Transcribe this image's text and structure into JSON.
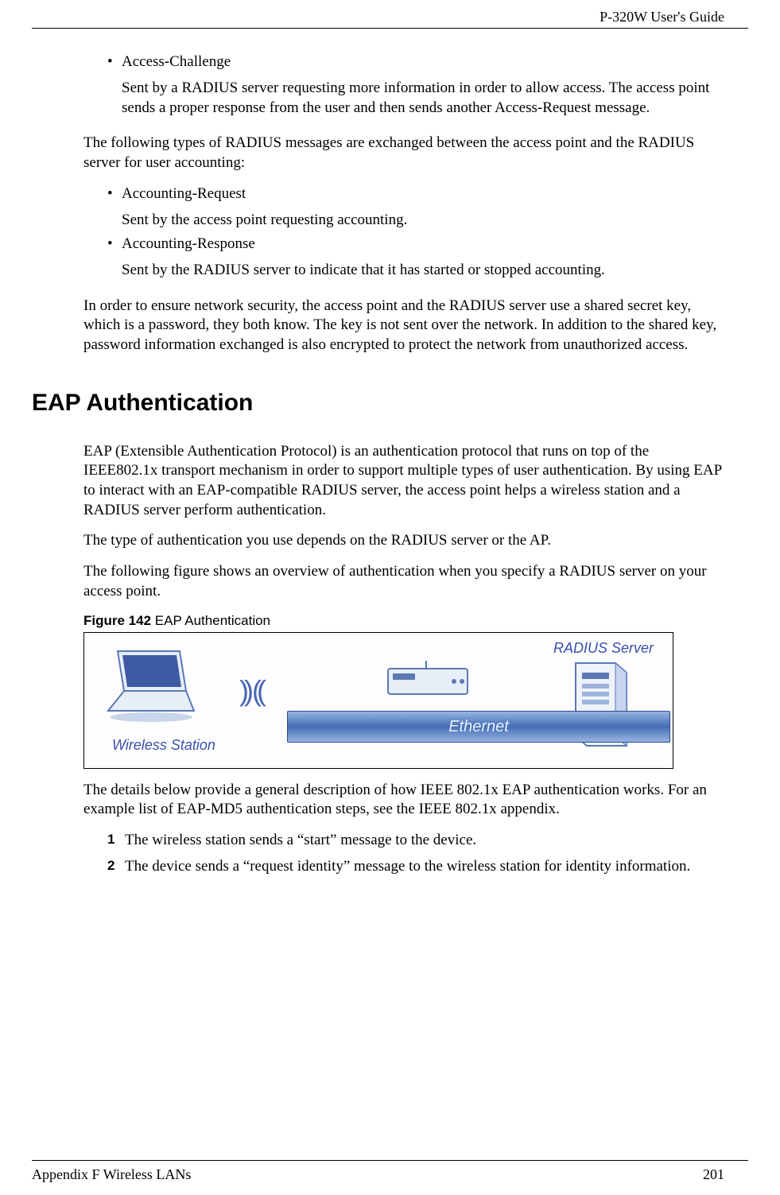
{
  "header": {
    "guide": "P-320W User's Guide"
  },
  "bullets1": [
    {
      "title": "Access-Challenge",
      "desc": "Sent by a RADIUS server requesting more information in order to allow access. The access point sends a proper response from the user and then sends another Access-Request message."
    }
  ],
  "para1": "The following types of RADIUS messages are exchanged between the access point and the RADIUS server for user accounting:",
  "bullets2": [
    {
      "title": "Accounting-Request",
      "desc": "Sent by the access point requesting accounting."
    },
    {
      "title": "Accounting-Response",
      "desc": "Sent by the RADIUS server to indicate that it has started or stopped accounting."
    }
  ],
  "para2": "In order to ensure network security, the access point and the RADIUS server use a shared secret key, which is a password, they both know. The key is not sent over the network. In addition to the shared key, password information exchanged is also encrypted to protect the network from unauthorized access.",
  "section_heading": "EAP Authentication",
  "para3": "EAP (Extensible Authentication Protocol) is an authentication protocol that runs on top of the IEEE802.1x transport mechanism in order to support multiple types of user authentication. By using EAP to interact with an EAP-compatible RADIUS server, the access point helps a wireless station and a RADIUS server perform authentication.",
  "para4": "The type of authentication you use depends on the RADIUS server or the AP.",
  "para5": "The following figure shows an overview of authentication when you specify a RADIUS server on your access point.",
  "figure": {
    "label_bold": "Figure 142",
    "label_rest": "   EAP Authentication",
    "wireless_station": "Wireless Station",
    "ethernet": "Ethernet",
    "radius_server": "RADIUS Server"
  },
  "para6": "The details below provide a general description of how IEEE 802.1x EAP authentication works. For an example list of EAP-MD5 authentication steps, see the IEEE 802.1x appendix.",
  "steps": [
    {
      "n": "1",
      "text": "The wireless station sends a “start” message to the device."
    },
    {
      "n": "2",
      "text": "The device sends a “request identity” message to the wireless station for identity information."
    }
  ],
  "footer": {
    "left": "Appendix F Wireless LANs",
    "right": "201"
  }
}
